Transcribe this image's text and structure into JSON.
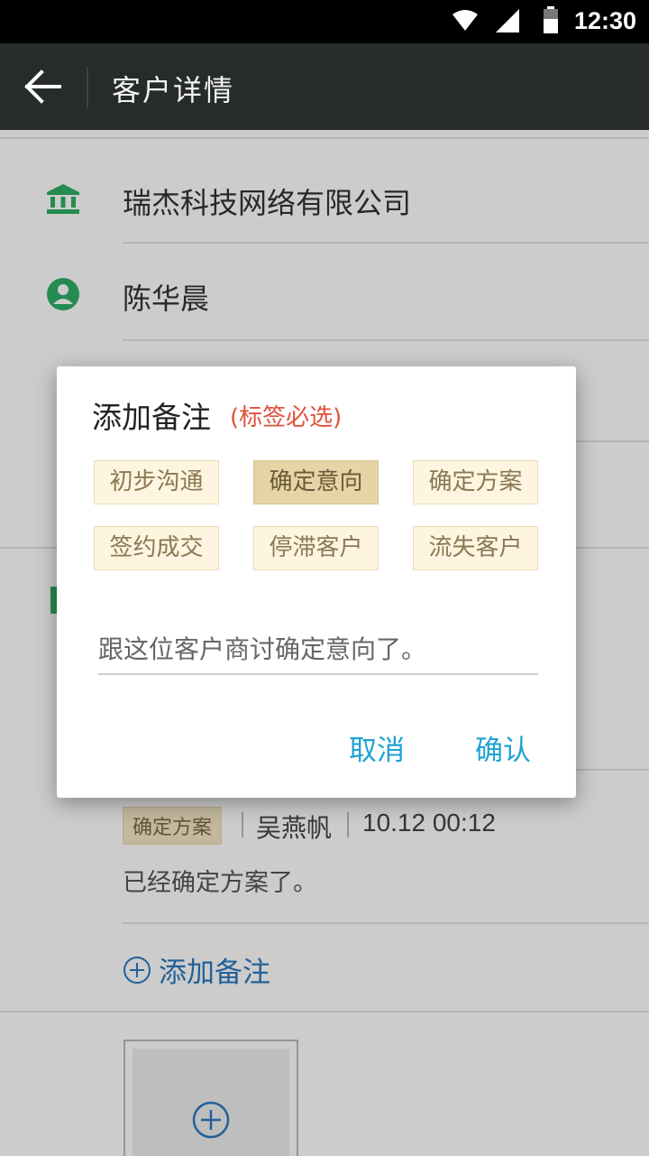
{
  "status_bar": {
    "time": "12:30"
  },
  "app_bar": {
    "title": "客户详情"
  },
  "customer": {
    "company": "瑞杰科技网络有限公司",
    "contact": "陈华晨"
  },
  "note": {
    "tag": "确定方案",
    "author": "吴燕帆",
    "time": "10.12 00:12",
    "text": "已经确定方案了。"
  },
  "add_note_label": "添加备注",
  "dialog": {
    "title": "添加备注",
    "hint": "(标签必选)",
    "tags": [
      "初步沟通",
      "确定意向",
      "确定方案",
      "签约成交",
      "停滞客户",
      "流失客户"
    ],
    "selected_tag": "确定意向",
    "input_value": "跟这位客户商讨确定意向了。",
    "cancel": "取消",
    "confirm": "确认"
  },
  "colors": {
    "accent": "#1ea3d2",
    "green": "#2fae64",
    "link": "#2b78c0",
    "hint": "#e0513b"
  }
}
